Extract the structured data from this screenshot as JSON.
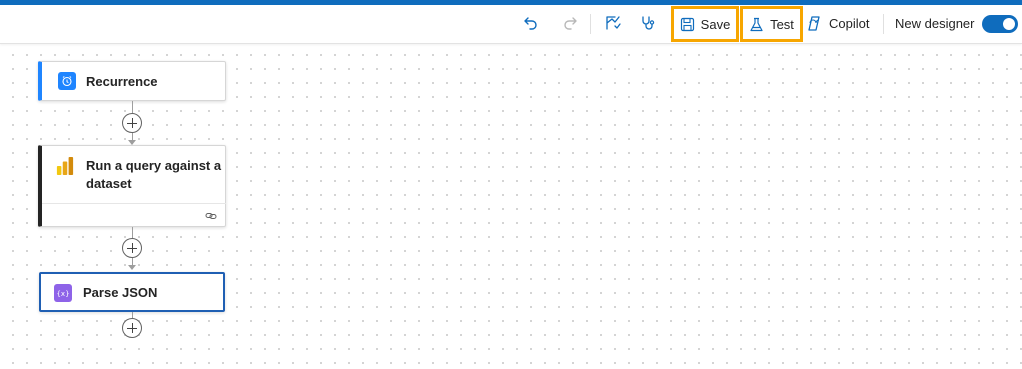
{
  "toolbar": {
    "undo_icon": "undo-icon",
    "redo_icon": "redo-icon",
    "flow_checker_icon": "flow-checker-icon",
    "health_icon": "stethoscope-icon",
    "save_label": "Save",
    "test_label": "Test",
    "copilot_label": "Copilot",
    "new_designer_label": "New designer",
    "new_designer_enabled": true,
    "accent_color": "#0f6cbd",
    "highlight_color": "#f7a600"
  },
  "canvas": {
    "steps": [
      {
        "title": "Recurrence",
        "icon": "clock-icon",
        "icon_color": "#1f85ff"
      },
      {
        "title": "Run a query against a dataset",
        "icon": "power-bi-icon",
        "icon_color": "#f2c811"
      },
      {
        "title": "Parse JSON",
        "icon": "variable-icon",
        "icon_color": "#8e63e8"
      }
    ]
  }
}
